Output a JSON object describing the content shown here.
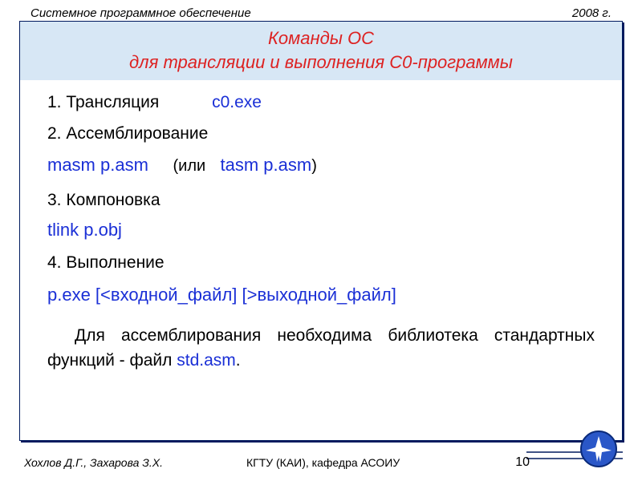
{
  "header": {
    "left": "Системное программное обеспечение",
    "right": "2008 г."
  },
  "title": {
    "line1": "Команды ОС",
    "line2": "для трансляции и выполнения  С0-программы"
  },
  "steps": {
    "s1_label": "1. Трансляция",
    "s1_cmd": "c0.exe",
    "s2_label": "2. Ассемблирование",
    "s2_cmd_a": "masm p.asm",
    "s2_or_open": "(или",
    "s2_cmd_b": "tasm p.asm",
    "s2_or_close": ")",
    "s3_label": "3. Компоновка",
    "s3_cmd": "tlink p.obj",
    "s4_label": "4. Выполнение",
    "s4_cmd": "p.exe   [<входной_файл]  [>выходной_файл]"
  },
  "paragraph": {
    "pre": "Для ассемблирования необходима библиотека стандартных функций - файл ",
    "file": "std.asm",
    "post": "."
  },
  "footer": {
    "authors": "Хохлов Д.Г., Захарова З.Х.",
    "org": "КГТУ  (КАИ),   кафедра АСОИУ",
    "page": "10"
  }
}
